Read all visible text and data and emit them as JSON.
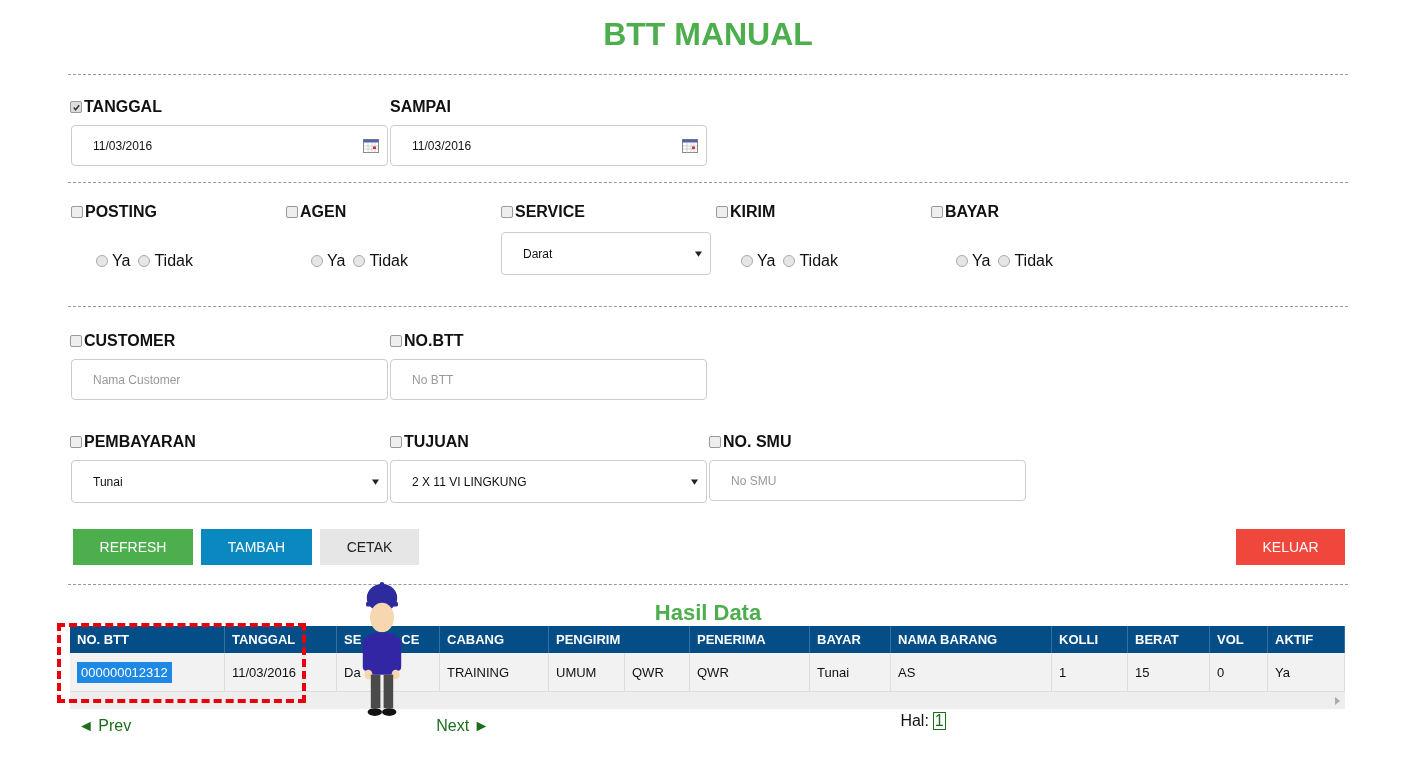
{
  "title": "BTT MANUAL",
  "date_filters": [
    {
      "kind": "checkbox",
      "label": "TANGGAL",
      "checked": true,
      "value": "11/03/2016"
    },
    {
      "kind": "plain",
      "label": "SAMPAI",
      "value": "11/03/2016"
    }
  ],
  "status_filters": [
    {
      "kind": "radio",
      "label": "POSTING",
      "checked": false,
      "options": [
        {
          "label": "Ya",
          "selected": false
        },
        {
          "label": "Tidak",
          "selected": false
        }
      ]
    },
    {
      "kind": "radio",
      "label": "AGEN",
      "checked": false,
      "options": [
        {
          "label": "Ya",
          "selected": false
        },
        {
          "label": "Tidak",
          "selected": false
        }
      ]
    },
    {
      "kind": "select",
      "label": "SERVICE",
      "checked": false,
      "value": "Darat"
    },
    {
      "kind": "radio",
      "label": "KIRIM",
      "checked": false,
      "options": [
        {
          "label": "Ya",
          "selected": false
        },
        {
          "label": "Tidak",
          "selected": false
        }
      ]
    },
    {
      "kind": "radio",
      "label": "BAYAR",
      "checked": false,
      "options": [
        {
          "label": "Ya",
          "selected": false
        },
        {
          "label": "Tidak",
          "selected": false
        }
      ]
    }
  ],
  "text_filters": [
    {
      "kind": "input",
      "label": "CUSTOMER",
      "checked": false,
      "placeholder": "Nama Customer"
    },
    {
      "kind": "input",
      "label": "NO.BTT",
      "checked": false,
      "placeholder": "No BTT"
    }
  ],
  "select_filters": [
    {
      "kind": "select",
      "label": "PEMBAYARAN",
      "checked": false,
      "value": "Tunai"
    },
    {
      "kind": "select",
      "label": "TUJUAN",
      "checked": false,
      "value": "2 X 11 VI LINGKUNG"
    },
    {
      "kind": "input",
      "label": "NO. SMU",
      "checked": false,
      "placeholder": "No SMU"
    }
  ],
  "buttons": [
    {
      "label": "REFRESH",
      "kind": "success"
    },
    {
      "label": "TAMBAH",
      "kind": "info"
    },
    {
      "label": "CETAK",
      "kind": "default"
    },
    {
      "label": "KELUAR",
      "kind": "danger"
    }
  ],
  "results": {
    "title": "Hasil Data",
    "columns": [
      {
        "label": "NO. BTT"
      },
      {
        "label": "TANGGAL"
      },
      {
        "label": "SE",
        "label_end": "CE"
      },
      {
        "label": "CABANG"
      },
      {
        "label": "PENGIRIM"
      },
      {
        "label": "PENERIMA"
      },
      {
        "label": "BAYAR"
      },
      {
        "label": "NAMA BARANG"
      },
      {
        "label": "KOLLI"
      },
      {
        "label": "BERAT"
      },
      {
        "label": "VOL"
      },
      {
        "label": "AKTIF"
      }
    ],
    "rows": [
      {
        "cells": [
          {
            "text": "000000012312",
            "highlighted": true
          },
          {
            "text": "11/03/2016",
            "highlighted": false
          },
          {
            "text": "Da",
            "highlighted": false
          },
          {
            "text": "TRAINING",
            "highlighted": false
          },
          {
            "text": "UMUM",
            "text_2": "QWR",
            "highlighted": false
          },
          {
            "text": "QWR",
            "highlighted": false
          },
          {
            "text": "Tunai",
            "highlighted": false
          },
          {
            "text": "AS",
            "highlighted": false
          },
          {
            "text": "1",
            "highlighted": false
          },
          {
            "text": "15",
            "highlighted": false
          },
          {
            "text": "0",
            "highlighted": false
          },
          {
            "text": "Ya",
            "highlighted": false
          }
        ]
      }
    ]
  },
  "pagination": {
    "prev": "◄ Prev",
    "next": "Next ►",
    "label": "Hal:",
    "pages": [
      {
        "label": "1",
        "selected": true
      }
    ]
  }
}
